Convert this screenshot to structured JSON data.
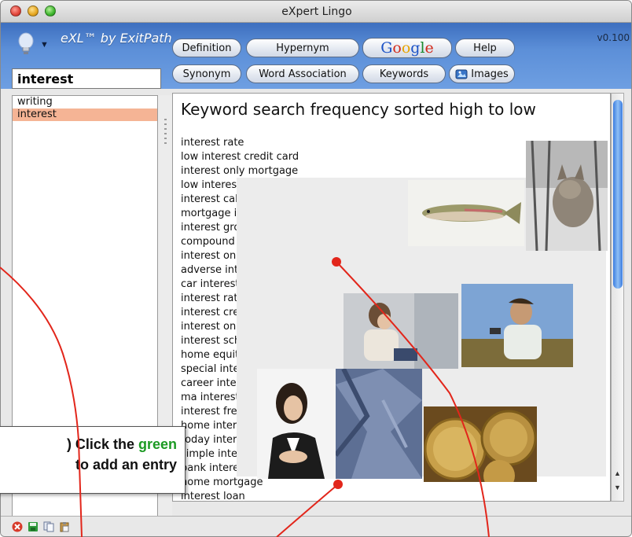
{
  "window": {
    "title": "eXpert Lingo",
    "version": "v0.100"
  },
  "toolbar": {
    "brand": "eXL™ by ExitPath",
    "buttons_row1": [
      "Definition",
      "Hypernym",
      "Help"
    ],
    "buttons_row2": [
      "Synonym",
      "Word Association",
      "Keywords",
      "Images"
    ],
    "google_label": [
      "G",
      "o",
      "o",
      "g",
      "l",
      "e"
    ]
  },
  "search": {
    "value": "interest"
  },
  "sidebar": {
    "items": [
      "writing",
      "interest"
    ],
    "selected": "interest"
  },
  "main": {
    "heading": "Keyword search frequency sorted high to low",
    "keywords": [
      "interest rate",
      "low interest credit card",
      "interest only mortgage",
      "low interest rate credit card",
      "interest calculator",
      "mortgage interest",
      "interest group",
      "compound interest",
      "interest only loan calculator",
      "adverse interest mortgage",
      "car interest",
      "interest rate calculator",
      "interest credit card",
      "interest only home loan",
      "interest school",
      "home equity loan interest rate",
      "special interest",
      "career interest",
      "ma interest rate",
      "interest free credit",
      "home interest",
      "today interest",
      "simple interest",
      "bank interest",
      "home mortgage",
      "interest loan"
    ]
  },
  "callout": {
    "prefix": ") Click the ",
    "highlight": "green",
    "line2": "to add an entry"
  },
  "colors": {
    "accent_blue": "#5c8fd8",
    "selection": "#f5b495",
    "annotation_red": "#e2261b",
    "callout_green": "#1c9a23"
  }
}
